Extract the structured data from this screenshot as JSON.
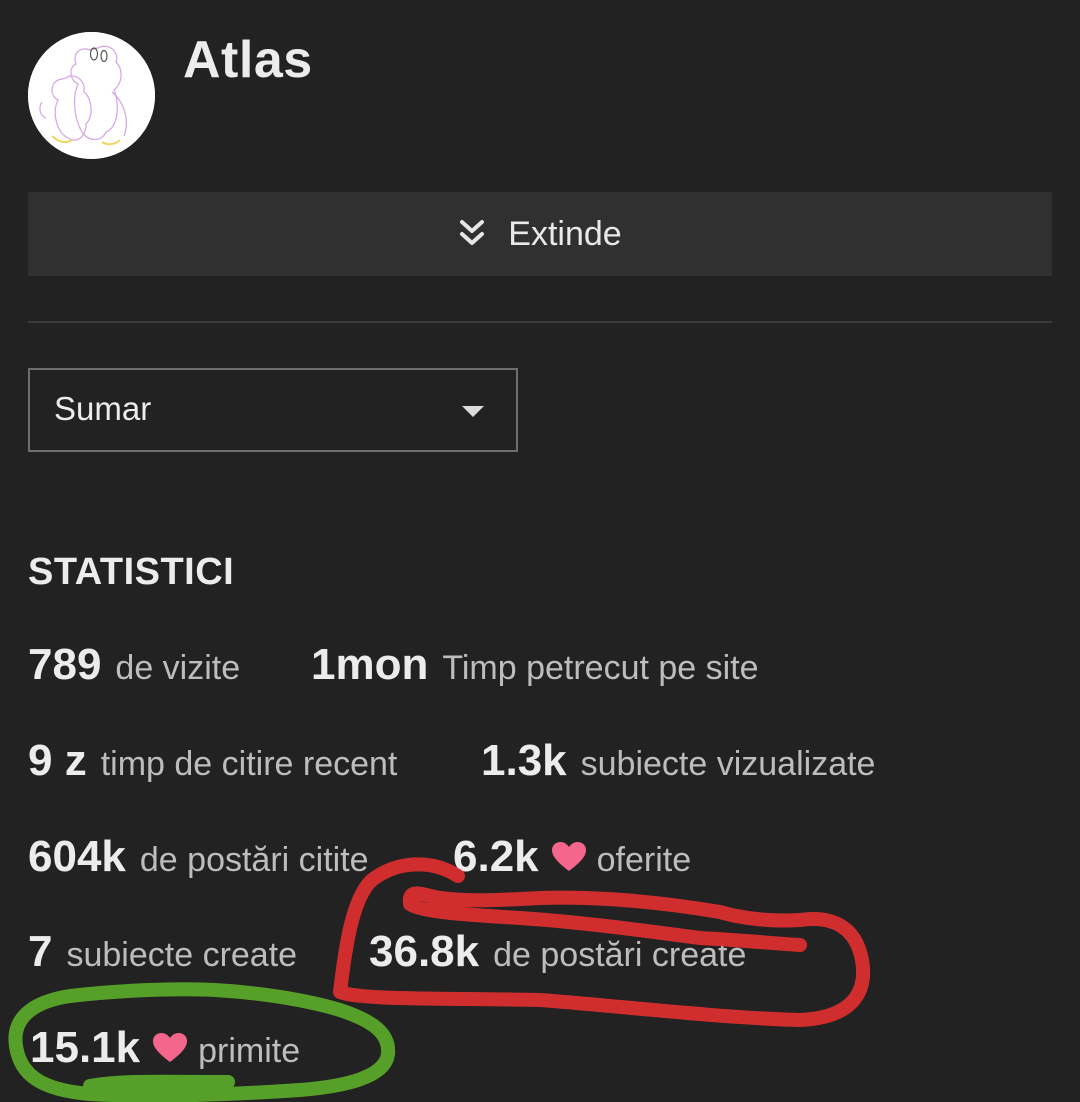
{
  "profile": {
    "username": "Atlas",
    "avatar_icon": "avatar-drawing"
  },
  "expand": {
    "label": "Extinde",
    "icon": "double-chevron-down-icon"
  },
  "view_select": {
    "selected": "Sumar"
  },
  "stats": {
    "title": "STATISTICI",
    "items": [
      {
        "value": "789",
        "label": "de vizite"
      },
      {
        "value": "1mon",
        "label": "Timp petrecut pe site"
      },
      {
        "value": "9 z",
        "label": "timp de citire recent"
      },
      {
        "value": "1.3k",
        "label": "subiecte vizualizate"
      },
      {
        "value": "604k",
        "label": "de postări citite"
      },
      {
        "value": "6.2k",
        "label": "oferite",
        "icon": "heart-icon"
      },
      {
        "value": "7",
        "label": "subiecte create"
      },
      {
        "value": "36.8k",
        "label": "de postări create"
      },
      {
        "value": "15.1k",
        "label": "primite",
        "icon": "heart-icon"
      }
    ]
  },
  "colors": {
    "background": "#222222",
    "heart": "#f4668c",
    "annotation_red": "#e03030",
    "annotation_green": "#5aa82a"
  }
}
